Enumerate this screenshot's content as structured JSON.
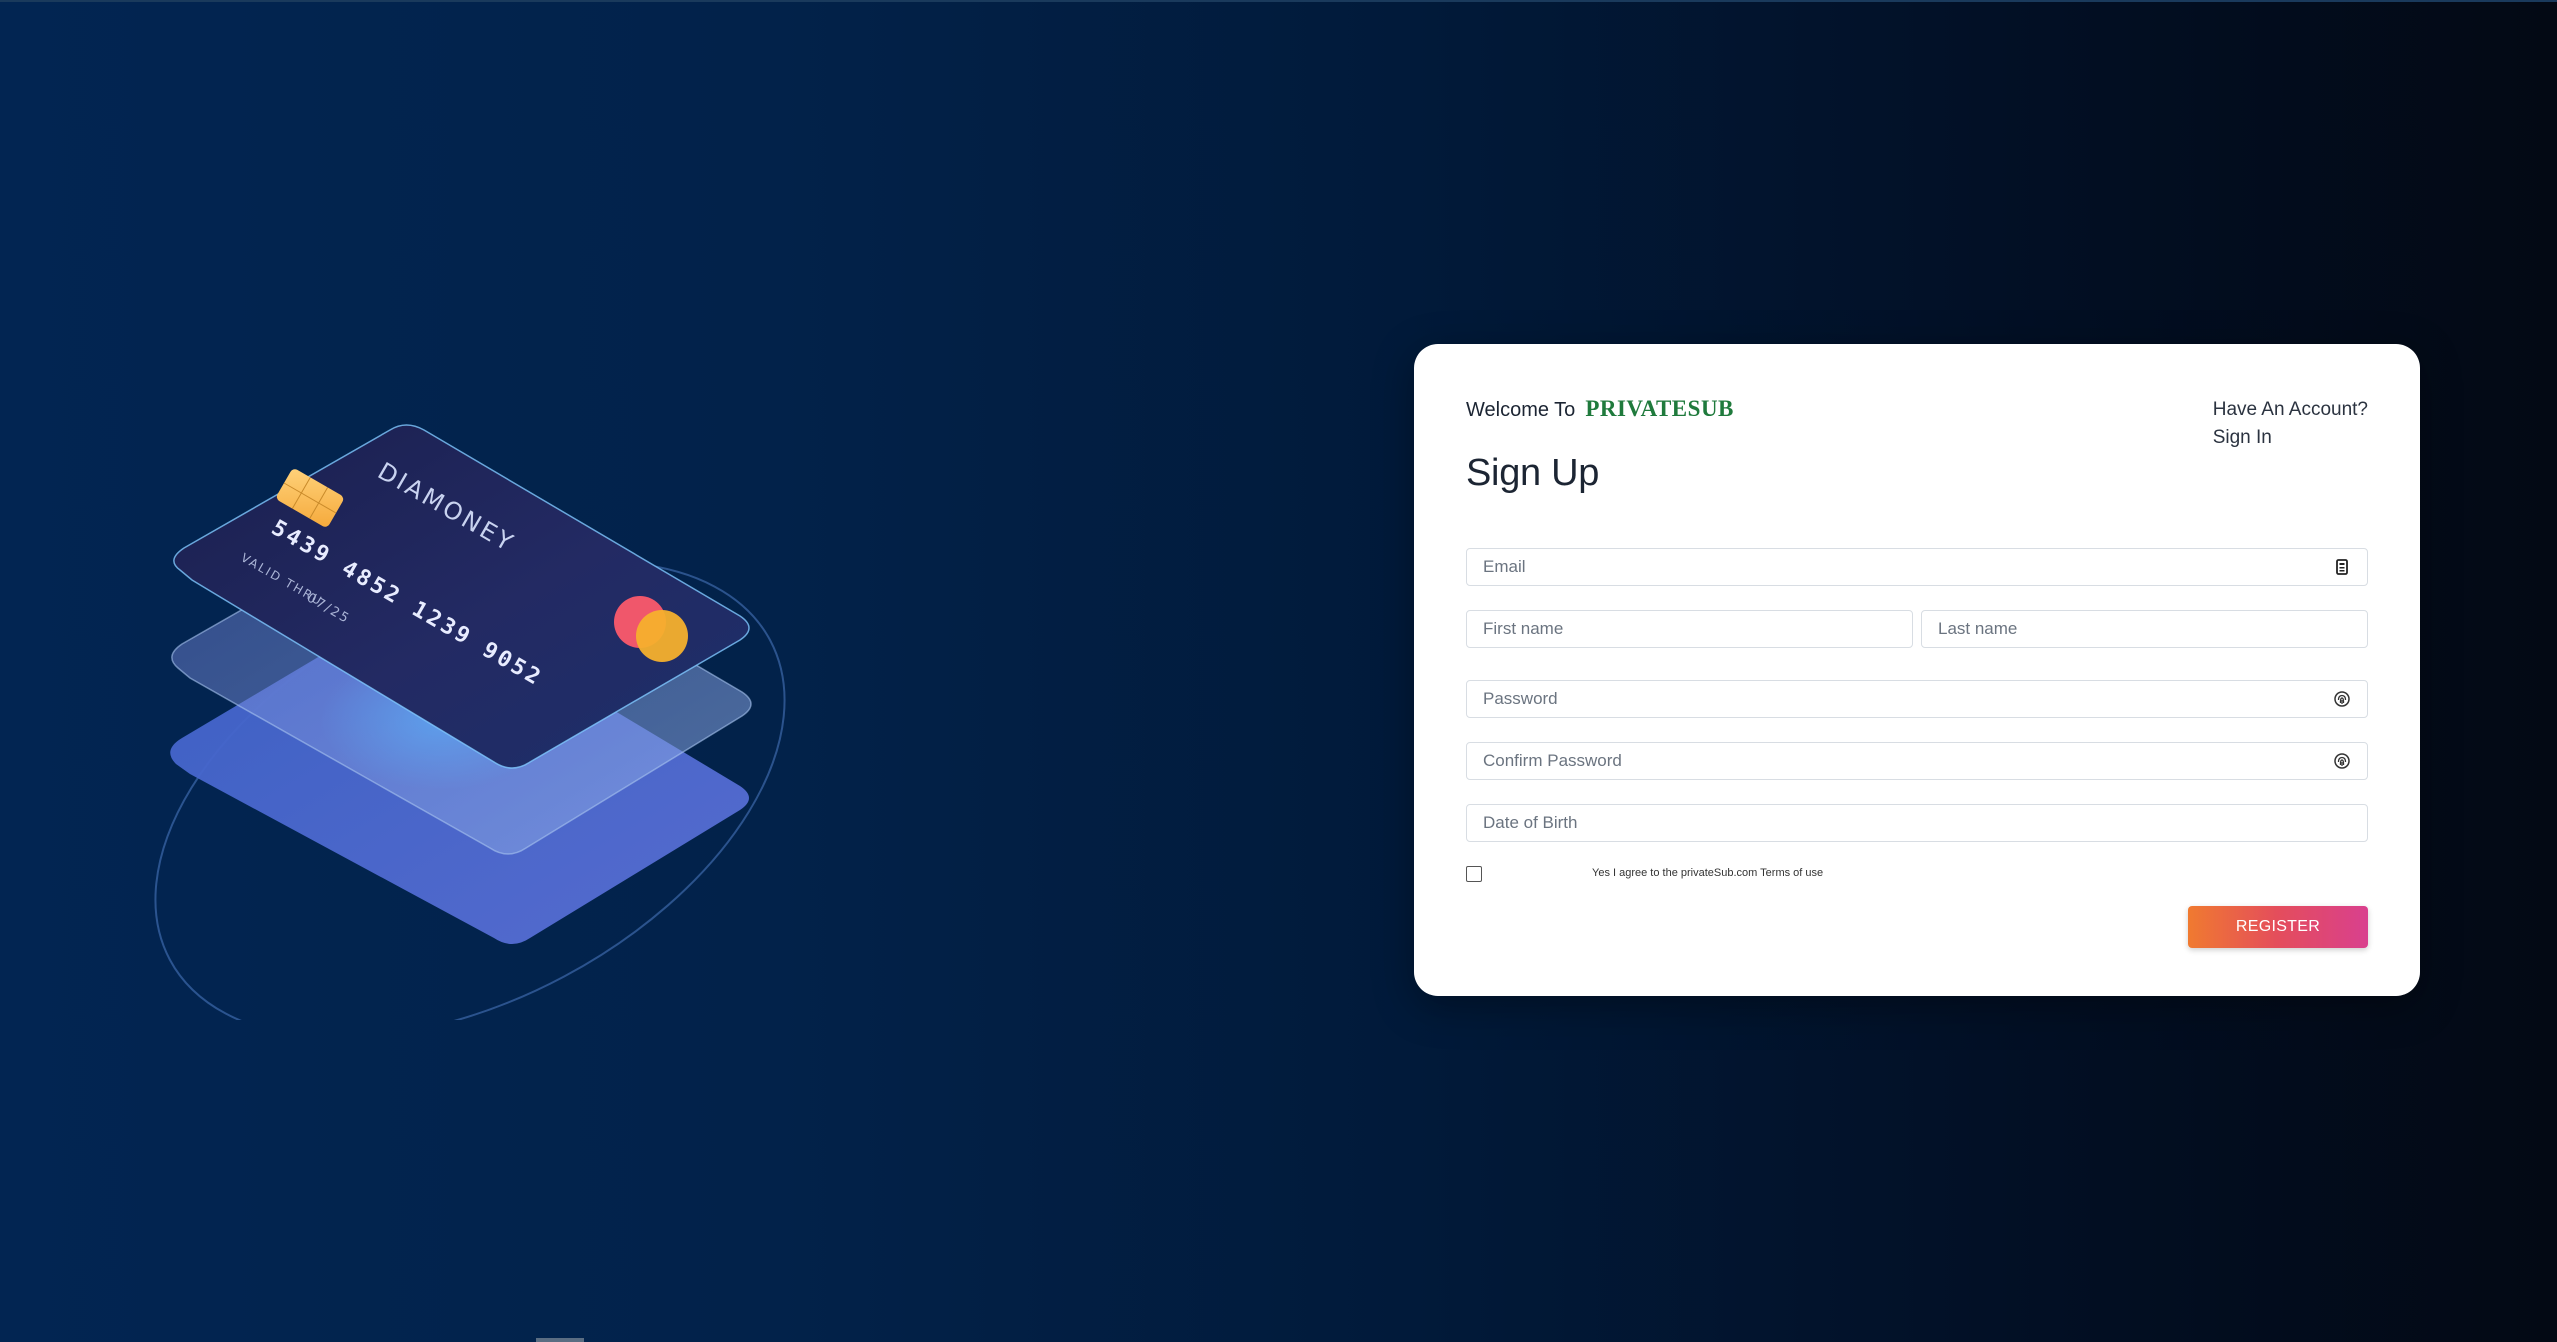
{
  "header": {
    "welcome_text": "Welcome To",
    "brand_name": "PRIVATESUB",
    "have_account_text": "Have An Account?",
    "sign_in_link": "Sign In",
    "title": "Sign Up"
  },
  "form": {
    "email": {
      "placeholder": "Email",
      "value": "",
      "icon": "id-card-icon"
    },
    "first_name": {
      "placeholder": "First name",
      "value": ""
    },
    "last_name": {
      "placeholder": "Last name",
      "value": ""
    },
    "password": {
      "placeholder": "Password",
      "value": "",
      "icon": "fingerprint-icon"
    },
    "confirm_password": {
      "placeholder": "Confirm Password",
      "value": "",
      "icon": "fingerprint-icon"
    },
    "date_of_birth": {
      "placeholder": "Date of Birth",
      "value": ""
    },
    "agree_text": "Yes I agree to the privateSub.com Terms of use",
    "agree_checked": false,
    "register_label": "REGISTER"
  },
  "illustration": {
    "card_brand": "DIAMONEY",
    "card_number": "5439 4852 1239 9052",
    "valid_thru_label": "VALID THRU",
    "expiry": "07/25"
  },
  "colors": {
    "background_left": "#022552",
    "background_right": "#030914",
    "brand": "#1f7a3c",
    "button_start": "#f07a30",
    "button_end": "#d9408e"
  }
}
